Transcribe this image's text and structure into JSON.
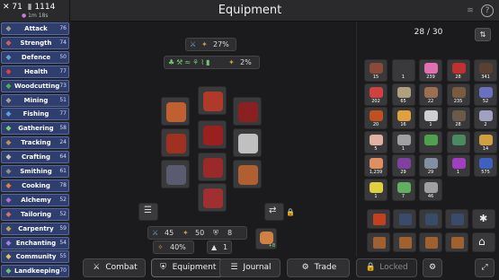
{
  "stats": {
    "combat_level": "71",
    "total_level": "1114",
    "playtime": "1m 18s"
  },
  "header": {
    "title": "Equipment"
  },
  "skills": [
    {
      "name": "Attack",
      "level": "76",
      "icon": "sword-icon",
      "color": "#9a9a9a"
    },
    {
      "name": "Strength",
      "level": "74",
      "icon": "fist-icon",
      "color": "#d06060"
    },
    {
      "name": "Defence",
      "level": "50",
      "icon": "shield-icon",
      "color": "#60a0d0"
    },
    {
      "name": "Health",
      "level": "77",
      "icon": "heart-icon",
      "color": "#e04040"
    },
    {
      "name": "Woodcutting",
      "level": "73",
      "icon": "tree-icon",
      "color": "#4caf50"
    },
    {
      "name": "Mining",
      "level": "51",
      "icon": "pickaxe-icon",
      "color": "#a0a0a0"
    },
    {
      "name": "Fishing",
      "level": "77",
      "icon": "fish-icon",
      "color": "#5aa0e0"
    },
    {
      "name": "Gathering",
      "level": "58",
      "icon": "leaf-icon",
      "color": "#7ad07a"
    },
    {
      "name": "Tracking",
      "level": "24",
      "icon": "paw-icon",
      "color": "#c09060"
    },
    {
      "name": "Crafting",
      "level": "64",
      "icon": "scissors-icon",
      "color": "#c0c0c0"
    },
    {
      "name": "Smithing",
      "level": "61",
      "icon": "anvil-icon",
      "color": "#909090"
    },
    {
      "name": "Cooking",
      "level": "78",
      "icon": "pot-icon",
      "color": "#e08040"
    },
    {
      "name": "Alchemy",
      "level": "52",
      "icon": "potion-icon",
      "color": "#b070d0"
    },
    {
      "name": "Tailoring",
      "level": "52",
      "icon": "needle-icon",
      "color": "#d07070"
    },
    {
      "name": "Carpentry",
      "level": "59",
      "icon": "saw-icon",
      "color": "#c0a060"
    },
    {
      "name": "Enchanting",
      "level": "54",
      "icon": "star-icon",
      "color": "#a080e0"
    },
    {
      "name": "Community",
      "level": "55",
      "icon": "people-icon",
      "color": "#e0c060"
    },
    {
      "name": "Landkeeping",
      "level": "70",
      "icon": "field-icon",
      "color": "#70c070"
    }
  ],
  "equipment": {
    "speed_pct": "27%",
    "gather_pct": "2%",
    "attack": "45",
    "strength": "50",
    "defence": "8",
    "crit_pct": "40%",
    "arrow_level": "1",
    "food_bonus": "+8"
  },
  "inventory": {
    "count": "28 / 30",
    "items": [
      {
        "qty": "15",
        "color": "#8a4a3a"
      },
      {
        "qty": "1",
        "color": "#3a3a3a"
      },
      {
        "qty": "239",
        "color": "#e070b0"
      },
      {
        "qty": "28",
        "color": "#c03030"
      },
      {
        "qty": "341",
        "color": "#5a4030"
      },
      {
        "qty": "202",
        "color": "#d04040"
      },
      {
        "qty": "65",
        "color": "#b0a080"
      },
      {
        "qty": "22",
        "color": "#9a7050"
      },
      {
        "qty": "235",
        "color": "#7a5a40"
      },
      {
        "qty": "52",
        "color": "#6a70c0"
      },
      {
        "qty": "20",
        "color": "#c05020"
      },
      {
        "qty": "16",
        "color": "#e0a040"
      },
      {
        "qty": "1",
        "color": "#d0d0d0"
      },
      {
        "qty": "28",
        "color": "#6a5a4a"
      },
      {
        "qty": "2",
        "color": "#a0a0c0"
      },
      {
        "qty": "5",
        "color": "#e0b0a0"
      },
      {
        "qty": "1",
        "color": "#a0a0a0"
      },
      {
        "qty": "",
        "color": "#50a050"
      },
      {
        "qty": "",
        "color": "#4a8a60"
      },
      {
        "qty": "14",
        "color": "#d0a040"
      },
      {
        "qty": "1,239",
        "color": "#e09060"
      },
      {
        "qty": "29",
        "color": "#8040a0"
      },
      {
        "qty": "29",
        "color": "#8090a0"
      },
      {
        "qty": "1",
        "color": "#a040c0"
      },
      {
        "qty": "575",
        "color": "#4060c0"
      },
      {
        "qty": "1",
        "color": "#e0d040"
      },
      {
        "qty": "7",
        "color": "#60b060"
      },
      {
        "qty": "46",
        "color": "#a0a0a0"
      }
    ]
  },
  "nav": {
    "combat": "Combat",
    "equipment": "Equipment",
    "journal": "Journal",
    "trade": "Trade",
    "locked": "Locked"
  }
}
